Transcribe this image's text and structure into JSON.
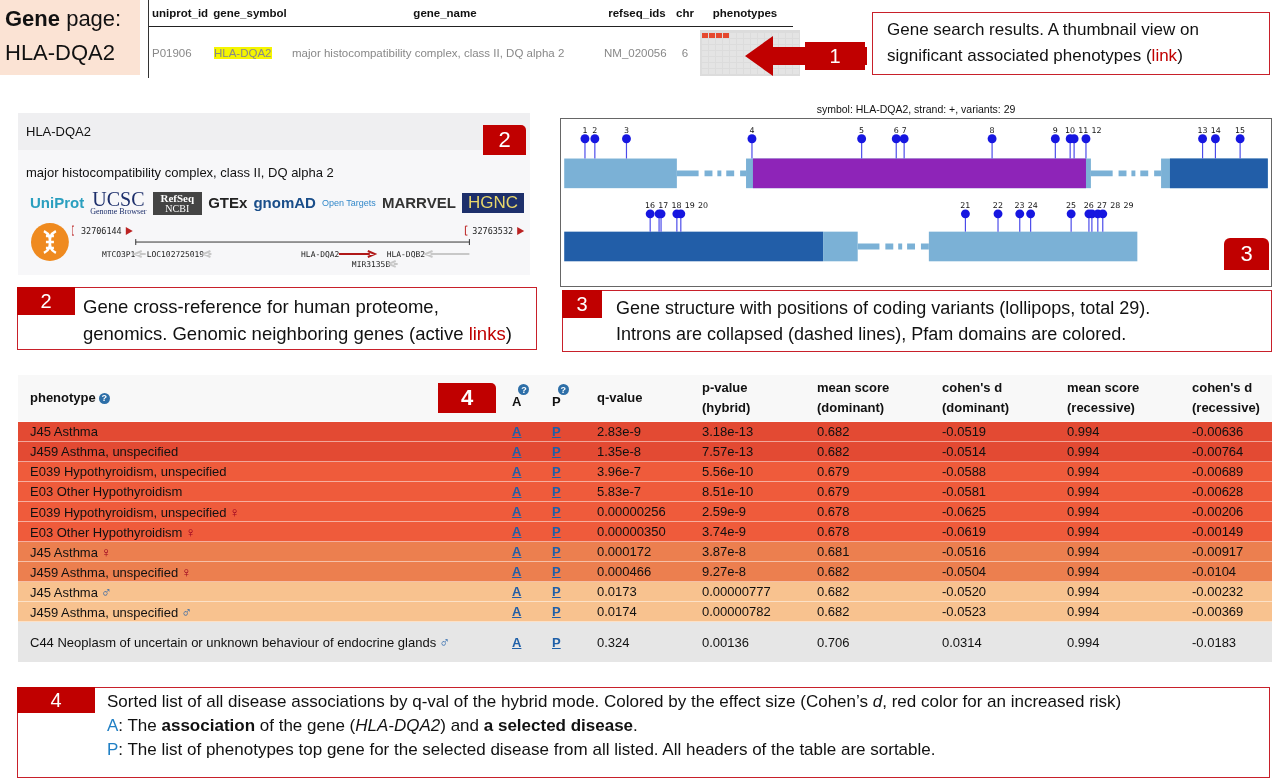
{
  "title_box": {
    "lines": [
      "**Gene** page:",
      "HLA-DQA2"
    ]
  },
  "search_table": {
    "columns": [
      "uniprot_id",
      "gene_symbol",
      "gene_name",
      "refseq_ids",
      "chr",
      "phenotypes"
    ],
    "row": {
      "uniprot_id": "P01906",
      "gene_symbol": "HLA-DQA2",
      "gene_symbol_highlighted": true,
      "gene_name": "major histocompatibility complex, class II, DQ alpha 2",
      "refseq_ids": "NM_020056",
      "chr": "6"
    }
  },
  "callouts": [
    {
      "number": "1",
      "lines": [
        [
          {
            "kind": "plain",
            "text": "Gene search results. A thumbnail view on"
          }
        ],
        [
          {
            "kind": "plain",
            "text": "significant associated phenotypes ("
          },
          {
            "kind": "link",
            "text": "link"
          },
          {
            "kind": "plain",
            "text": ")"
          }
        ]
      ]
    },
    {
      "number": "2",
      "lines": [
        [
          {
            "kind": "plain",
            "text": "Gene cross-reference for human proteome,"
          }
        ],
        [
          {
            "kind": "plain",
            "text": "genomics. Genomic neighboring genes (active "
          },
          {
            "kind": "link",
            "text": "links"
          },
          {
            "kind": "plain",
            "text": ")"
          }
        ]
      ]
    },
    {
      "number": "3",
      "lines": [
        [
          {
            "kind": "plain",
            "text": "Gene structure with positions of coding variants (lollipops, total 29)."
          }
        ],
        [
          {
            "kind": "plain",
            "text": "Introns are collapsed (dashed lines), Pfam domains are colored."
          }
        ]
      ]
    },
    {
      "number": "4",
      "lines": [
        [
          {
            "kind": "plain",
            "text": "Sorted list of all disease associations by q-val of the hybrid mode. Colored by the effect size (Cohen’s *d*, red color for an increased risk)"
          }
        ],
        [
          {
            "kind": "key",
            "text": "A"
          },
          {
            "kind": "plain",
            "text": ": The **association** of the gene (*HLA-DQA2*) and **a selected disease**."
          }
        ],
        [
          {
            "kind": "key",
            "text": "P"
          },
          {
            "kind": "plain",
            "text": ": The list of phenotypes top gene for the selected disease from all listed.  All headers of the table are sortable."
          }
        ]
      ]
    }
  ],
  "gene_card": {
    "symbol": "HLA-DQA2",
    "badge": "2",
    "name": "major histocompatibility complex, class II, DQ alpha 2",
    "logos": [
      {
        "label": "UniProt",
        "kind": "text",
        "color": "#2a9fbf"
      },
      {
        "label": "UCSC",
        "sub": "Genome Browser",
        "kind": "text",
        "color": "#1d2f6b"
      },
      {
        "label": "RefSeq",
        "sub": "NCBI",
        "kind": "dark"
      },
      {
        "label": "GTEx",
        "kind": "text",
        "color": "#222222"
      },
      {
        "label": "gnomAD",
        "kind": "text",
        "color": "#1a4e8a"
      },
      {
        "label": "Open Targets",
        "kind": "small"
      },
      {
        "label": "MARRVEL",
        "kind": "text",
        "color": "#333333"
      },
      {
        "label": "HGNC",
        "kind": "navy"
      }
    ],
    "locus": {
      "start": "32706144",
      "end": "32763532",
      "genes": [
        {
          "name": "MTCO3P1",
          "current": false
        },
        {
          "name": "LOC102725019",
          "current": false
        },
        {
          "name": "HLA-DQA2",
          "current": true
        },
        {
          "name": "HLA-DQB2",
          "current": false
        },
        {
          "name": "MIR3135B",
          "current": false
        }
      ]
    }
  },
  "gene_structure": {
    "title": "symbol: HLA-DQA2, strand: +, variants: 29",
    "badge": "3",
    "variants": [
      "1",
      "2",
      "3",
      "4",
      "5",
      "6",
      "7",
      "8",
      "9",
      "10",
      "11",
      "12",
      "13",
      "14",
      "15",
      "16",
      "17",
      "18",
      "19",
      "20",
      "21",
      "22",
      "23",
      "24",
      "25",
      "26",
      "27",
      "28",
      "29"
    ]
  },
  "phenotype_table": {
    "badge": "4",
    "columns": [
      {
        "lines": [
          "phenotype"
        ],
        "help": "?"
      },
      {
        "lines": [
          "A"
        ],
        "help": "?"
      },
      {
        "lines": [
          "P"
        ],
        "help": "?"
      },
      {
        "lines": [
          "q-value"
        ]
      },
      {
        "lines": [
          "p-value",
          "(hybrid)"
        ]
      },
      {
        "lines": [
          "mean score",
          "(dominant)"
        ]
      },
      {
        "lines": [
          "cohen's d",
          "(dominant)"
        ]
      },
      {
        "lines": [
          "mean score",
          "(recessive)"
        ]
      },
      {
        "lines": [
          "cohen's d",
          "(recessive)"
        ]
      }
    ],
    "rows": [
      {
        "phenotype": "J45 Asthma",
        "a": "A",
        "p": "P",
        "values": [
          "2.83e-9",
          "3.18e-13",
          "0.682",
          "-0.0519",
          "0.994",
          "-0.00636"
        ],
        "color": "#e34a33"
      },
      {
        "phenotype": "J459 Asthma, unspecified",
        "a": "A",
        "p": "P",
        "values": [
          "1.35e-8",
          "7.57e-13",
          "0.682",
          "-0.0514",
          "0.994",
          "-0.00764"
        ],
        "color": "#e34a33"
      },
      {
        "phenotype": "E039 Hypothyroidism, unspecified",
        "a": "A",
        "p": "P",
        "values": [
          "3.96e-7",
          "5.56e-10",
          "0.679",
          "-0.0588",
          "0.994",
          "-0.00689"
        ],
        "color": "#ef5b3b"
      },
      {
        "phenotype": "E03 Other Hypothyroidism",
        "a": "A",
        "p": "P",
        "values": [
          "5.83e-7",
          "8.51e-10",
          "0.679",
          "-0.0581",
          "0.994",
          "-0.00628"
        ],
        "color": "#ef5b3b"
      },
      {
        "phenotype": "E039 Hypothyroidism, unspecified",
        "marker": {
          "kind": "female",
          "text": "♀"
        },
        "a": "A",
        "p": "P",
        "values": [
          "0.00000256",
          "2.59e-9",
          "0.678",
          "-0.0625",
          "0.994",
          "-0.00206"
        ],
        "color": "#ef5b3b"
      },
      {
        "phenotype": "E03 Other Hypothyroidism",
        "marker": {
          "kind": "female",
          "text": "♀"
        },
        "a": "A",
        "p": "P",
        "values": [
          "0.00000350",
          "3.74e-9",
          "0.678",
          "-0.0619",
          "0.994",
          "-0.00149"
        ],
        "color": "#ef5b3b"
      },
      {
        "phenotype": "J45 Asthma",
        "marker": {
          "kind": "female",
          "text": "♀"
        },
        "a": "A",
        "p": "P",
        "values": [
          "0.000172",
          "3.87e-8",
          "0.681",
          "-0.0516",
          "0.994",
          "-0.00917"
        ],
        "color": "#ec7f4f"
      },
      {
        "phenotype": "J459 Asthma, unspecified",
        "marker": {
          "kind": "female",
          "text": "♀"
        },
        "a": "A",
        "p": "P",
        "values": [
          "0.000466",
          "9.27e-8",
          "0.682",
          "-0.0504",
          "0.994",
          "-0.0104"
        ],
        "color": "#ec7f4f"
      },
      {
        "phenotype": "J45 Asthma",
        "marker": {
          "kind": "male",
          "text": "♂"
        },
        "a": "A",
        "p": "P",
        "values": [
          "0.0173",
          "0.00000777",
          "0.682",
          "-0.0520",
          "0.994",
          "-0.00232"
        ],
        "color": "#f8c28f"
      },
      {
        "phenotype": "J459 Asthma, unspecified",
        "marker": {
          "kind": "male",
          "text": "♂"
        },
        "a": "A",
        "p": "P",
        "values": [
          "0.0174",
          "0.00000782",
          "0.682",
          "-0.0523",
          "0.994",
          "-0.00369"
        ],
        "color": "#f8c28f"
      },
      {
        "phenotype": "C44 Neoplasm of uncertain or unknown behaviour of endocrine glands",
        "marker": {
          "kind": "male",
          "text": "♂"
        },
        "a": "A",
        "p": "P",
        "values": [
          "0.324",
          "0.00136",
          "0.706",
          "0.0314",
          "0.994",
          "-0.0183"
        ],
        "color": "#e6e6e6"
      }
    ]
  }
}
